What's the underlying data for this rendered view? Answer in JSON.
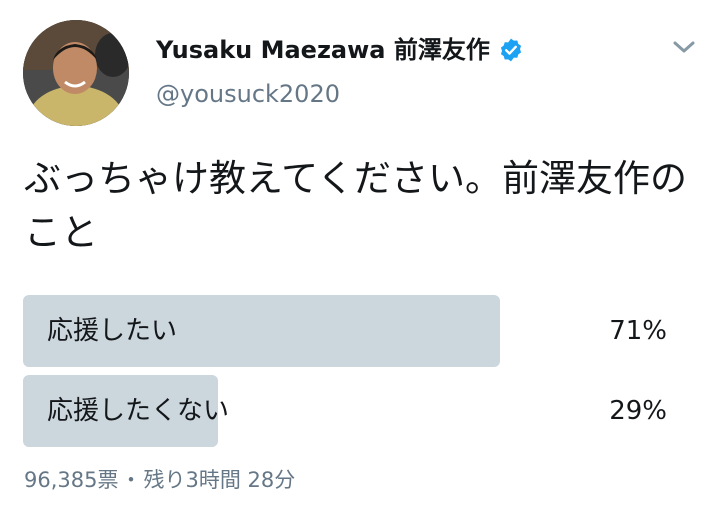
{
  "tweet": {
    "author_name": "Yusaku Maezawa 前澤友作",
    "handle": "@yousuck2020",
    "text": "ぶっちゃけ教えてください。前澤友作のこと"
  },
  "poll": {
    "choices": [
      {
        "label": "応援したい",
        "percent": "71%",
        "fraction": 0.71
      },
      {
        "label": "応援したくない",
        "percent": "29%",
        "fraction": 0.29
      }
    ],
    "votes": "96,385票",
    "separator": "・",
    "time_left": "残り3時間 28分"
  },
  "colors": {
    "verified": "#1da1f2",
    "bar": "#ccd6dd",
    "secondary_text": "#657786"
  },
  "icons": {
    "verified": "verified-badge-icon",
    "caret": "chevron-down-icon"
  }
}
